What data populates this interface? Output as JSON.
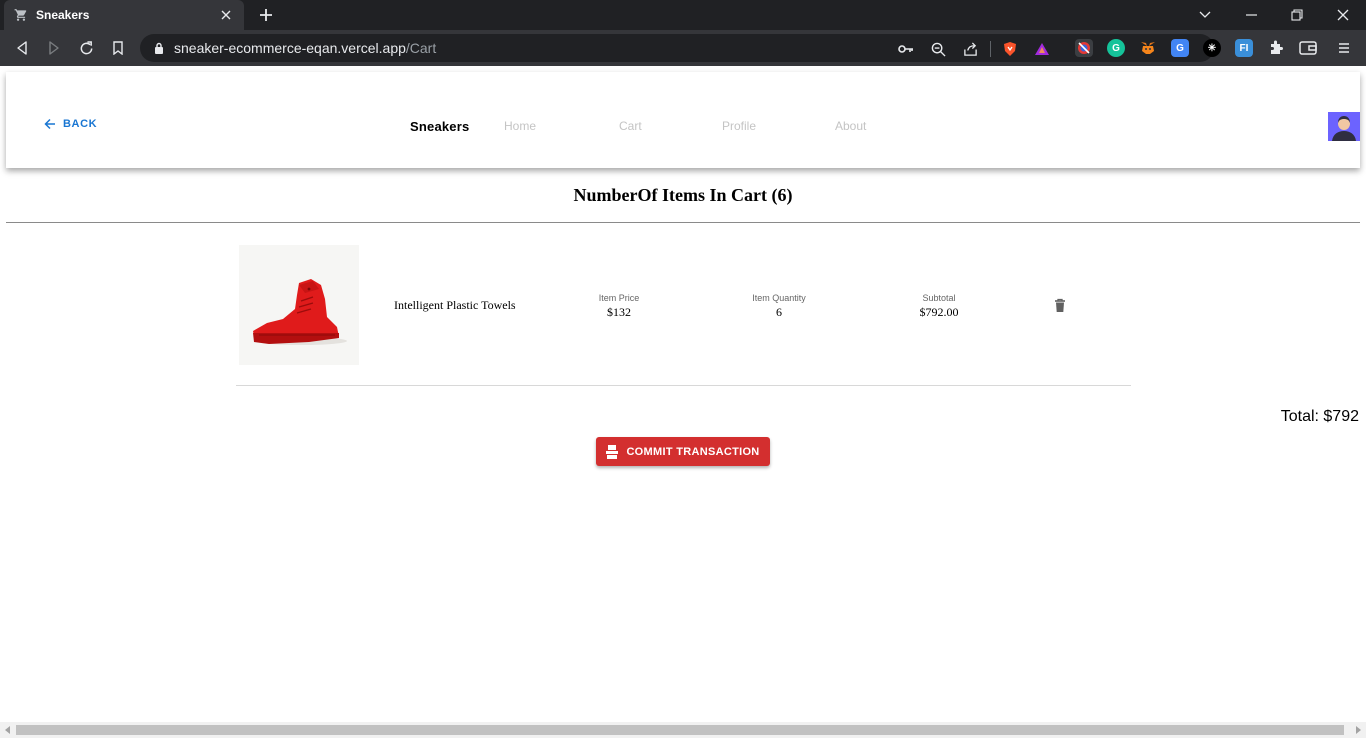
{
  "browser": {
    "tab_title": "Sneakers",
    "url_host": "sneaker-ecommerce-eqan.vercel.app",
    "url_path": "/Cart"
  },
  "header": {
    "back_label": "BACK",
    "brand": "Sneakers",
    "nav": [
      "Home",
      "Cart",
      "Profile",
      "About"
    ]
  },
  "cart": {
    "heading": "NumberOf Items In Cart (6)",
    "items": [
      {
        "name": "Intelligent Plastic Towels",
        "price_label": "Item Price",
        "price": "$132",
        "quantity_label": "Item Quantity",
        "quantity": "6",
        "subtotal_label": "Subtotal",
        "subtotal": "$792.00"
      }
    ],
    "total": "Total: $792",
    "commit_label": "COMMIT TRANSACTION"
  },
  "colors": {
    "accent_blue": "#1976d2",
    "commit_red": "#d32f2f",
    "avatar_bg": "#6c63ff"
  }
}
